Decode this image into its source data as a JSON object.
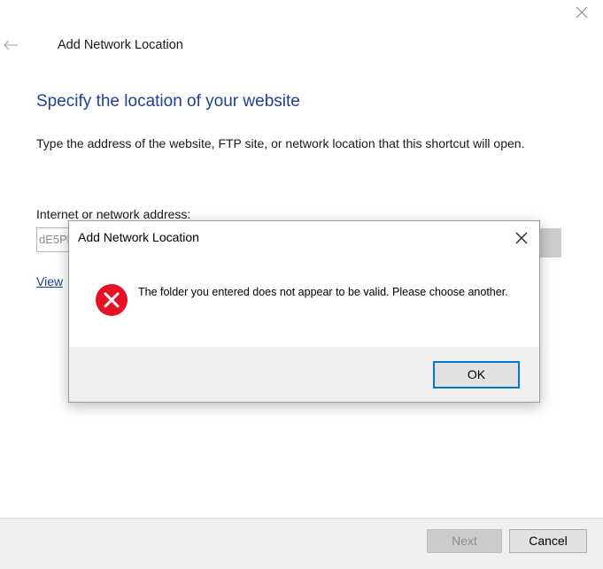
{
  "wizard": {
    "title": "Add Network Location",
    "heading": "Specify the location of your website",
    "description": "Type the address of the website, FTP site, or network location that this shortcut will open.",
    "address_label": "Internet or network address:",
    "address_value": "dE5Pl",
    "view_link": "View",
    "next_label": "Next",
    "cancel_label": "Cancel"
  },
  "message_box": {
    "title": "Add Network Location",
    "message": "The folder you entered does not appear to be valid.  Please choose another.",
    "ok_label": "OK",
    "icon": "error-icon"
  },
  "colors": {
    "heading": "#1f3f9a",
    "link": "#1f3f9a",
    "error": "#e81123",
    "focus_border": "#0078d7"
  }
}
